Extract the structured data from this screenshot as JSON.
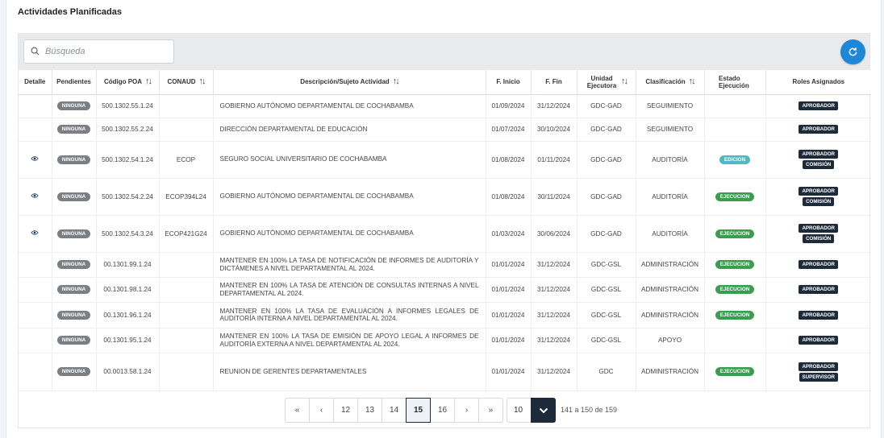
{
  "title": "Actividades Planificadas",
  "search": {
    "placeholder": "Búsqueda"
  },
  "columns": [
    "Detalle",
    "Pendientes",
    "Código POA",
    "CONAUD",
    "Descripción/Sujeto Actividad",
    "F. Inicio",
    "F. Fin",
    "Unidad Ejecutora",
    "Clasificación",
    "Estado Ejecución",
    "Roles Asignados"
  ],
  "rows": [
    {
      "detalle": false,
      "pendientes": "NINGUNA",
      "codigo": "500.1302.55.1.24",
      "conaud": "",
      "descripcion": "GOBIERNO AUTÓNOMO DEPARTAMENTAL DE COCHABAMBA",
      "inicio": "01/09/2024",
      "fin": "31/12/2024",
      "unidad": "GDC-GAD",
      "clasificacion": "SEGUIMIENTO",
      "estado": "",
      "roles": [
        "APROBADOR"
      ]
    },
    {
      "detalle": false,
      "pendientes": "NINGUNA",
      "codigo": "500.1302.55.2.24",
      "conaud": "",
      "descripcion": "DIRECCIÓN DEPARTAMENTAL DE EDUCACIÓN",
      "inicio": "01/07/2024",
      "fin": "30/10/2024",
      "unidad": "GDC-GAD",
      "clasificacion": "SEGUIMIENTO",
      "estado": "",
      "roles": [
        "APROBADOR"
      ]
    },
    {
      "detalle": true,
      "pendientes": "NINGUNA",
      "codigo": "500.1302.54.1.24",
      "conaud": "ECOP",
      "descripcion": "SEGURO SOCIAL UNIVERSITARIO DE COCHABAMBA",
      "inicio": "01/08/2024",
      "fin": "01/11/2024",
      "unidad": "GDC-GAD",
      "clasificacion": "AUDITORÍA",
      "estado": "EDICION",
      "roles": [
        "APROBADOR",
        "COMISIÓN"
      ]
    },
    {
      "detalle": true,
      "pendientes": "NINGUNA",
      "codigo": "500.1302.54.2.24",
      "conaud": "ECOP394L24",
      "descripcion": "GOBIERNO AUTÓNOMO DEPARTAMENTAL DE COCHABAMBA",
      "inicio": "01/08/2024",
      "fin": "30/11/2024",
      "unidad": "GDC-GAD",
      "clasificacion": "AUDITORÍA",
      "estado": "EJECUCION",
      "roles": [
        "APROBADOR",
        "COMISIÓN"
      ]
    },
    {
      "detalle": true,
      "pendientes": "NINGUNA",
      "codigo": "500.1302.54.3.24",
      "conaud": "ECOP421G24",
      "descripcion": "GOBIERNO AUTÓNOMO DEPARTAMENTAL DE COCHABAMBA",
      "inicio": "01/03/2024",
      "fin": "30/06/2024",
      "unidad": "GDC-GAD",
      "clasificacion": "AUDITORÍA",
      "estado": "EJECUCION",
      "roles": [
        "APROBADOR",
        "COMISIÓN"
      ]
    },
    {
      "detalle": false,
      "pendientes": "NINGUNA",
      "codigo": "00.1301.99.1.24",
      "conaud": "",
      "descripcion": "MANTENER EN 100% LA TASA DE NOTIFICACIÓN DE INFORMES DE AUDITORÍA Y DICTÁMENES A NIVEL DEPARTAMENTAL AL 2024.",
      "inicio": "01/01/2024",
      "fin": "31/12/2024",
      "unidad": "GDC-GSL",
      "clasificacion": "ADMINISTRACIÓN",
      "estado": "EJECUCION",
      "roles": [
        "APROBADOR"
      ]
    },
    {
      "detalle": false,
      "pendientes": "NINGUNA",
      "codigo": "00.1301.98.1.24",
      "conaud": "",
      "descripcion": "MANTENER EN 100% LA TASA DE ATENCIÓN DE CONSULTAS INTERNAS A NIVEL DEPARTAMENTAL AL 2024.",
      "inicio": "01/01/2024",
      "fin": "31/12/2024",
      "unidad": "GDC-GSL",
      "clasificacion": "ADMINISTRACIÓN",
      "estado": "EJECUCION",
      "roles": [
        "APROBADOR"
      ]
    },
    {
      "detalle": false,
      "pendientes": "NINGUNA",
      "codigo": "00.1301.96.1.24",
      "conaud": "",
      "descripcion": "MANTENER EN 100% LA TASA DE EVALUACIÓN A INFORMES LEGALES DE AUDITORÍA INTERNA A NIVEL DEPARTAMENTAL AL 2024.",
      "inicio": "01/01/2024",
      "fin": "31/12/2024",
      "unidad": "GDC-GSL",
      "clasificacion": "ADMINISTRACIÓN",
      "estado": "EJECUCION",
      "roles": [
        "APROBADOR"
      ]
    },
    {
      "detalle": false,
      "pendientes": "NINGUNA",
      "codigo": "00.1301.95.1.24",
      "conaud": "",
      "descripcion": "MANTENER EN 100% LA TASA DE EMISIÓN DE APOYO LEGAL A INFORMES DE AUDITORÍA EXTERNA A NIVEL DEPARTAMENTAL AL 2024.",
      "inicio": "01/01/2024",
      "fin": "31/12/2024",
      "unidad": "GDC-GSL",
      "clasificacion": "APOYO",
      "estado": "",
      "roles": [
        "APROBADOR"
      ]
    },
    {
      "detalle": false,
      "pendientes": "NINGUNA",
      "codigo": "00.0013.58.1.24",
      "conaud": "",
      "descripcion": "REUNION DE GERENTES DEPARTAMENTALES",
      "inicio": "01/01/2024",
      "fin": "31/12/2024",
      "unidad": "GDC",
      "clasificacion": "ADMINISTRACIÓN",
      "estado": "EJECUCION",
      "roles": [
        "APROBADOR",
        "SUPERVISOR"
      ]
    }
  ],
  "pagination": {
    "first": "«",
    "prev": "‹",
    "pages": [
      "12",
      "13",
      "14",
      "15",
      "16"
    ],
    "current": "15",
    "next": "›",
    "last": "»",
    "page_size": "10",
    "range": "141 a 150 de 159"
  },
  "colors": {
    "accent": "#1e88d8",
    "dark": "#1d2a3a",
    "green": "#3b9d4e",
    "teal": "#4fb8c0",
    "gray": "#7b7f84"
  }
}
